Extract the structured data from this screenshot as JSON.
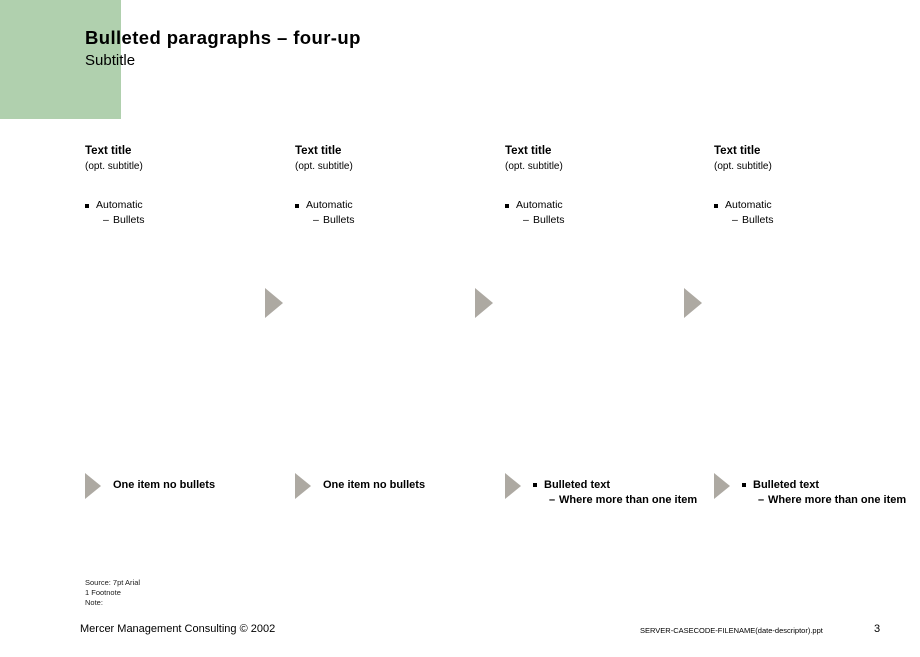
{
  "slide": {
    "title": "Bulleted paragraphs – four-up",
    "subtitle": "Subtitle",
    "accent_color": "#b0d0ae",
    "arrow_color": "#ada9a2"
  },
  "columns": [
    {
      "title": "Text title",
      "subtitle": "(opt. subtitle)",
      "bullets": [
        {
          "level": 1,
          "marker": "square-bullet",
          "text": "Automatic"
        },
        {
          "level": 2,
          "marker": "–",
          "text": "Bullets"
        }
      ]
    },
    {
      "title": "Text title",
      "subtitle": "(opt. subtitle)",
      "bullets": [
        {
          "level": 1,
          "marker": "square-bullet",
          "text": "Automatic"
        },
        {
          "level": 2,
          "marker": "–",
          "text": "Bullets"
        }
      ]
    },
    {
      "title": "Text title",
      "subtitle": "(opt. subtitle)",
      "bullets": [
        {
          "level": 1,
          "marker": "square-bullet",
          "text": "Automatic"
        },
        {
          "level": 2,
          "marker": "–",
          "text": "Bullets"
        }
      ]
    },
    {
      "title": "Text title",
      "subtitle": "(opt. subtitle)",
      "bullets": [
        {
          "level": 1,
          "marker": "square-bullet",
          "text": "Automatic"
        },
        {
          "level": 2,
          "marker": "–",
          "text": "Bullets"
        }
      ]
    }
  ],
  "mid_arrows": [
    {
      "icon": "triangle-right-icon"
    },
    {
      "icon": "triangle-right-icon"
    },
    {
      "icon": "triangle-right-icon"
    }
  ],
  "bottom_row": [
    {
      "icon": "triangle-right-icon",
      "style": "plain",
      "plain_text": "One item no bullets"
    },
    {
      "icon": "triangle-right-icon",
      "style": "plain",
      "plain_text": "One item no bullets"
    },
    {
      "icon": "triangle-right-icon",
      "style": "bulleted",
      "bullet_1": "Bulleted text",
      "bullet_2_dash": "–",
      "bullet_2": "Where more than one item"
    },
    {
      "icon": "triangle-right-icon",
      "style": "bulleted",
      "bullet_1": "Bulleted text",
      "bullet_2_dash": "–",
      "bullet_2": "Where more than one item"
    }
  ],
  "source": {
    "line1": "Source: 7pt Arial",
    "line2": "1  Footnote",
    "line3": "Note:"
  },
  "footer": {
    "left": "Mercer Management  Consulting © 2002",
    "filename": "SERVER-CASECODE-FILENAME(date-descriptor).ppt",
    "page": "3"
  }
}
